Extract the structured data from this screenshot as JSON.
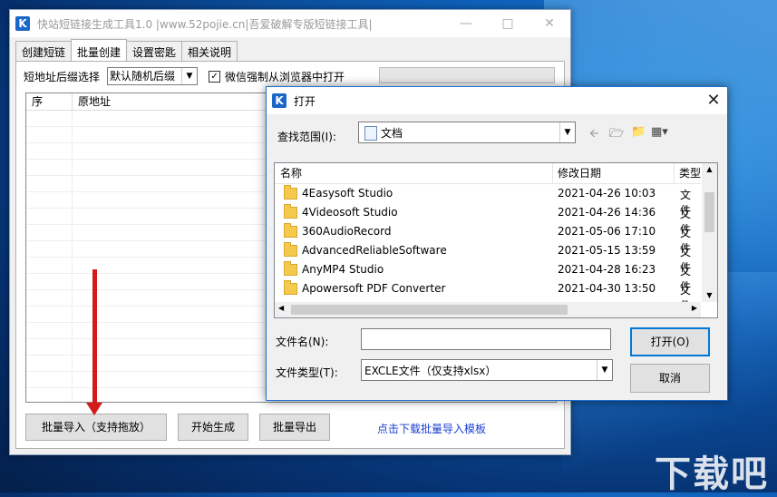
{
  "main_window": {
    "title": "快站短链接生成工具1.0 |www.52pojie.cn|吾爱破解专版短链接工具|",
    "tabs": [
      "创建短链",
      "批量创建",
      "设置密匙",
      "相关说明"
    ],
    "suffix_label": "短地址后缀选择",
    "suffix_value": "默认随机后缀",
    "wechat_check_label": "微信强制从浏览器中打开",
    "wechat_checked": true,
    "grid_columns": [
      "序",
      "原地址"
    ],
    "buttons": {
      "import": "批量导入（支持拖放）",
      "generate": "开始生成",
      "export": "批量导出"
    },
    "download_link": "点击下载批量导入模板"
  },
  "open_dialog": {
    "title": "打开",
    "look_in_label": "查找范围(I):",
    "look_in_value": "文档",
    "columns": {
      "name": "名称",
      "date": "修改日期",
      "type": "类型"
    },
    "files": [
      {
        "name": "4Easysoft Studio",
        "date": "2021-04-26 10:03",
        "type": "文件"
      },
      {
        "name": "4Videosoft Studio",
        "date": "2021-04-26 14:36",
        "type": "文件"
      },
      {
        "name": "360AudioRecord",
        "date": "2021-05-06 17:10",
        "type": "文件"
      },
      {
        "name": "AdvancedReliableSoftware",
        "date": "2021-05-15 13:59",
        "type": "文件"
      },
      {
        "name": "AnyMP4 Studio",
        "date": "2021-04-28 16:23",
        "type": "文件"
      },
      {
        "name": "Apowersoft PDF Converter",
        "date": "2021-04-30 13:50",
        "type": "文件"
      }
    ],
    "filename_label": "文件名(N):",
    "filename_value": "",
    "filetype_label": "文件类型(T):",
    "filetype_value": "EXCLE文件（仅支持xlsx）",
    "open_button": "打开(O)",
    "cancel_button": "取消"
  },
  "watermark": "下载吧",
  "colors": {
    "accent": "#0078d7",
    "link": "#1a3fd1",
    "arrow": "#d41b1b"
  }
}
